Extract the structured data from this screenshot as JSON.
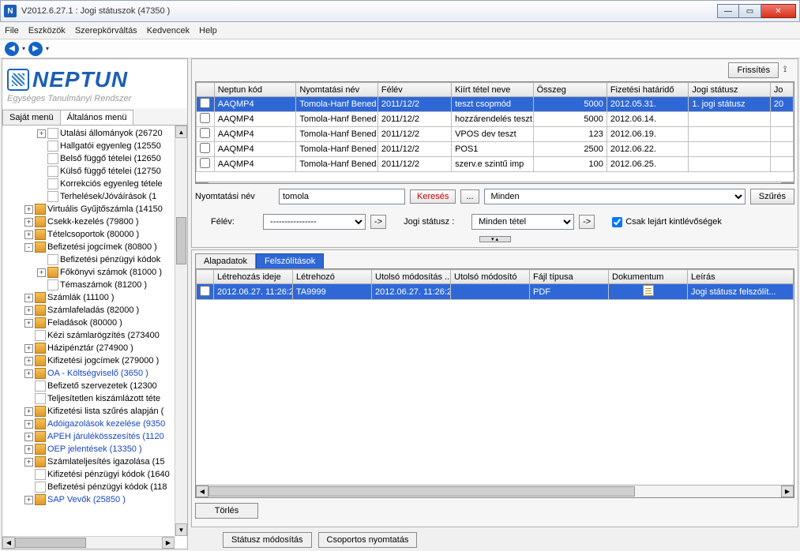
{
  "window": {
    "title": "V2012.6.27.1 : Jogi státuszok (47350  )"
  },
  "menubar": {
    "items": [
      "File",
      "Eszközök",
      "Szerepkörváltás",
      "Kedvencek",
      "Help"
    ]
  },
  "logo": {
    "word": "NEPTUN",
    "sub": "Egységes Tanulmányi Rendszer"
  },
  "left_tabs": {
    "tab1": "Saját menü",
    "tab2": "Általános menü"
  },
  "tree": [
    {
      "pm": "+",
      "ic": "doc",
      "label": "Utalási állományok (26720",
      "i": 2
    },
    {
      "pm": "",
      "ic": "doc",
      "label": "Hallgatói egyenleg (12550",
      "i": 2
    },
    {
      "pm": "",
      "ic": "doc",
      "label": "Belső függő tételei (12650",
      "i": 2
    },
    {
      "pm": "",
      "ic": "doc",
      "label": "Külső függő tételei (12750",
      "i": 2
    },
    {
      "pm": "",
      "ic": "doc",
      "label": "Korrekciós egyenleg tétele",
      "i": 2
    },
    {
      "pm": "",
      "ic": "doc",
      "label": "Terhelések/Jóváírások (1",
      "i": 2
    },
    {
      "pm": "+",
      "ic": "book",
      "label": "Virtuális Gyűjtőszámla (14150",
      "i": 1
    },
    {
      "pm": "+",
      "ic": "book",
      "label": "Csekk-kezelés (79800  )",
      "i": 1
    },
    {
      "pm": "+",
      "ic": "book",
      "label": "Tételcsoportok (80000  )",
      "i": 1
    },
    {
      "pm": "-",
      "ic": "book",
      "label": "Befizetési jogcímek (80800  )",
      "i": 1
    },
    {
      "pm": "",
      "ic": "doc",
      "label": "Befizetési pénzügyi kódok",
      "i": 2
    },
    {
      "pm": "+",
      "ic": "book",
      "label": "Főkönyvi számok (81000  )",
      "i": 2
    },
    {
      "pm": "",
      "ic": "doc",
      "label": "Témaszámok (81200  )",
      "i": 2
    },
    {
      "pm": "+",
      "ic": "book",
      "label": "Számlák (11100  )",
      "i": 1
    },
    {
      "pm": "+",
      "ic": "book",
      "label": "Számlafeladás (82000  )",
      "i": 1
    },
    {
      "pm": "+",
      "ic": "book",
      "label": "Feladások (80000  )",
      "i": 1
    },
    {
      "pm": "",
      "ic": "doc",
      "label": "Kézi számlarögzítés (273400",
      "i": 1
    },
    {
      "pm": "+",
      "ic": "book",
      "label": "Házipénztár (274900  )",
      "i": 1
    },
    {
      "pm": "+",
      "ic": "book",
      "label": "Kifizetési jogcímek (279000  )",
      "i": 1
    },
    {
      "pm": "+",
      "ic": "book",
      "label": "OA - Költségviselő (3650  )",
      "i": 1,
      "link": true
    },
    {
      "pm": "",
      "ic": "doc",
      "label": "Befizető szervezetek (12300",
      "i": 1
    },
    {
      "pm": "",
      "ic": "doc",
      "label": "Teljesítetlen kiszámlázott téte",
      "i": 1
    },
    {
      "pm": "+",
      "ic": "book",
      "label": "Kifizetési lista szűrés alapján (",
      "i": 1
    },
    {
      "pm": "+",
      "ic": "book",
      "label": "Adóigazolások kezelése (9350",
      "i": 1,
      "link": true
    },
    {
      "pm": "+",
      "ic": "book",
      "label": "APEH járulékösszesítés (1120",
      "i": 1,
      "link": true
    },
    {
      "pm": "+",
      "ic": "book",
      "label": "OEP jelentések (13350  )",
      "i": 1,
      "link": true
    },
    {
      "pm": "+",
      "ic": "book",
      "label": "Számlateljesítés igazolása (15",
      "i": 1
    },
    {
      "pm": "",
      "ic": "doc",
      "label": "Kifizetési pénzügyi kódok (1640",
      "i": 1
    },
    {
      "pm": "",
      "ic": "doc",
      "label": "Befizetési pénzügyi kódok (118",
      "i": 1
    },
    {
      "pm": "+",
      "ic": "book",
      "label": "SAP Vevők (25850  )",
      "i": 1,
      "link": true
    }
  ],
  "right_top": {
    "refresh": "Frissítés",
    "columns": [
      "",
      "Neptun kód",
      "Nyomtatási név",
      "Félév",
      "Kiírt tétel neve",
      "Összeg",
      "Fizetési határidő",
      "Jogi státusz",
      "Jo"
    ],
    "rows": [
      {
        "sel": true,
        "kod": "AAQMP4",
        "nev": "Tomola-Hanf Bened",
        "felev": "2011/12/2",
        "tetel": "teszt csopmód",
        "osszeg": "5000",
        "hat": "2012.05.31.",
        "stat": "1. jogi státusz",
        "jo": "20"
      },
      {
        "kod": "AAQMP4",
        "nev": "Tomola-Hanf Bened",
        "felev": "2011/12/2",
        "tetel": "hozzárendelés teszt",
        "osszeg": "5000",
        "hat": "2012.06.14.",
        "stat": "",
        "jo": ""
      },
      {
        "kod": "AAQMP4",
        "nev": "Tomola-Hanf Bened",
        "felev": "2011/12/2",
        "tetel": "VPOS dev teszt",
        "osszeg": "123",
        "hat": "2012.06.19.",
        "stat": "",
        "jo": ""
      },
      {
        "kod": "AAQMP4",
        "nev": "Tomola-Hanf Bened",
        "felev": "2011/12/2",
        "tetel": "POS1",
        "osszeg": "2500",
        "hat": "2012.06.22.",
        "stat": "",
        "jo": ""
      },
      {
        "kod": "AAQMP4",
        "nev": "Tomola-Hanf Bened",
        "felev": "2011/12/2",
        "tetel": "szerv.e szintű imp",
        "osszeg": "100",
        "hat": "2012.06.25.",
        "stat": "",
        "jo": ""
      }
    ]
  },
  "filters": {
    "print_name_label": "Nyomtatási név",
    "print_name_value": "tomola",
    "search_btn": "Keresés",
    "dots": "...",
    "scope_value": "Minden",
    "filter_btn": "Szűrés",
    "felev_label": "Félév:",
    "felev_value": "----------------",
    "arrow": "->",
    "jogi_label": "Jogi státusz :",
    "jogi_value": "Minden tétel",
    "expired_label": "Csak lejárt kintlévőségek"
  },
  "sub_tabs": {
    "tab1": "Alapadatok",
    "tab2": "Felszólítások"
  },
  "right_bottom": {
    "columns": [
      "",
      "Létrehozás ideje",
      "Létrehozó",
      "Utolsó módosítás ...",
      "Utolsó módosító",
      "Fájl típusa",
      "Dokumentum",
      "Leírás"
    ],
    "row": {
      "l_ideje": "2012.06.27. 11:26:2",
      "letrehozo": "TA9999",
      "u_mod": "2012.06.27. 11:26:2",
      "u_modito": "",
      "fajl": "PDF",
      "leiras": "Jogi státusz felszólít..."
    },
    "delete_btn": "Törlés"
  },
  "footer": {
    "btn1": "Státusz módosítás",
    "btn2": "Csoportos nyomtatás"
  }
}
